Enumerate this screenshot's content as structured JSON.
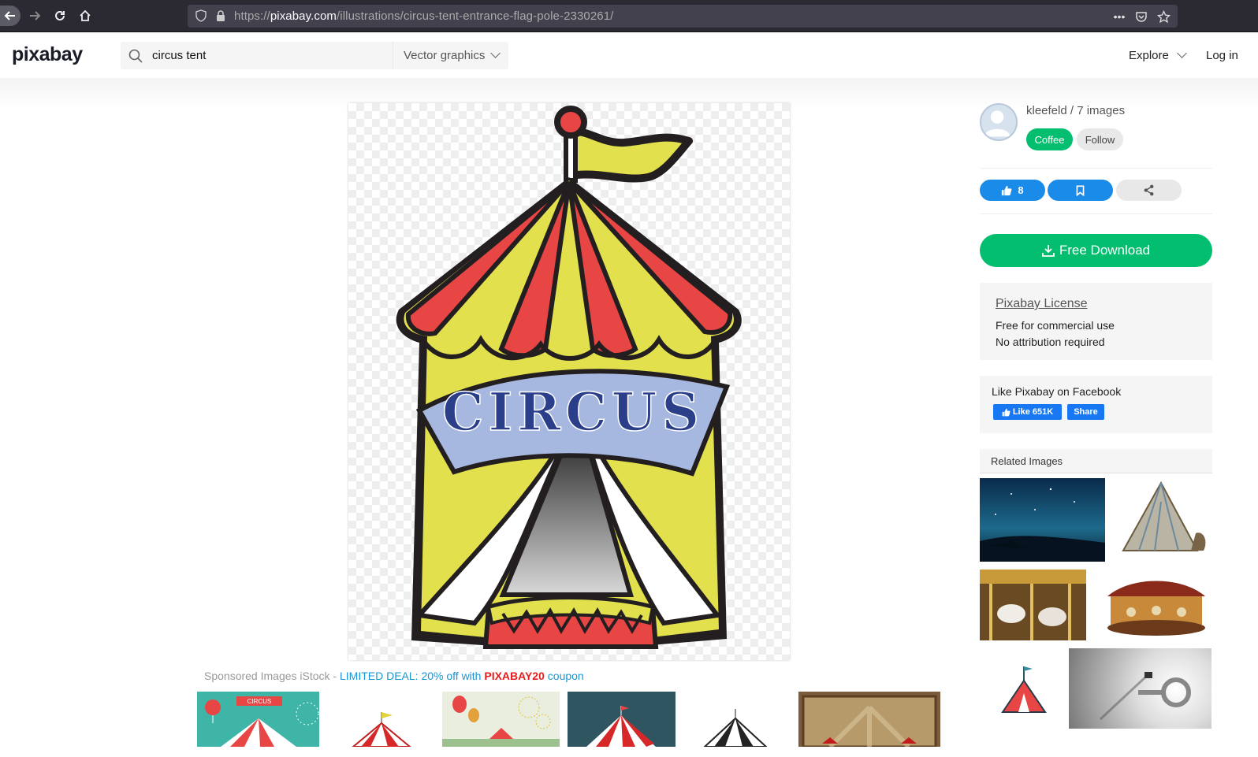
{
  "browser": {
    "url_scheme": "https://",
    "url_host": "pixabay.com",
    "url_path": "/illustrations/circus-tent-entrance-flag-pole-2330261/"
  },
  "header": {
    "logo": "pixabay",
    "search_value": "circus tent",
    "search_type": "Vector graphics",
    "explore": "Explore",
    "login": "Log in"
  },
  "image": {
    "banner_text": "CIRCUS"
  },
  "sponsored": {
    "prefix": "Sponsored Images iStock - ",
    "deal": "LIMITED DEAL: 20% off with ",
    "code": "PIXABAY20",
    "suffix": " coupon"
  },
  "sidebar": {
    "user": "kleefeld / 7 images",
    "coffee": "Coffee",
    "follow": "Follow",
    "likes": "8",
    "download": "Free Download",
    "license_title": "Pixabay License",
    "license_line1": "Free for commercial use",
    "license_line2": "No attribution required",
    "facebook_title": "Like Pixabay on Facebook",
    "fb_like": "Like 651K",
    "fb_share": "Share",
    "related_title": "Related Images"
  },
  "thumb_labels": {
    "circus_banner": "CIRCUS"
  },
  "colors": {
    "green": "#02be6e",
    "blue": "#1a8be8",
    "tent_yellow": "#e2e04c",
    "tent_red": "#e84545",
    "banner_blue": "#a6b8e0"
  }
}
